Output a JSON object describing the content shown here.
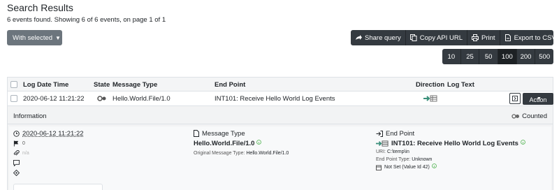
{
  "header": {
    "title": "Search Results",
    "summary": "6 events found. Showing 6 of 6 events, on page 1 of 1"
  },
  "bulk": {
    "with_selected_label": "With selected"
  },
  "toolbar": {
    "share_query": "Share query",
    "copy_api_url": "Copy API URL",
    "print": "Print",
    "export_csv": "Export to CSV"
  },
  "pager": {
    "sizes": [
      "10",
      "25",
      "50",
      "100",
      "200",
      "500"
    ],
    "active": "100"
  },
  "table": {
    "columns": {
      "log_date_time": "Log Date Time",
      "state": "State",
      "message_type": "Message Type",
      "end_point": "End Point",
      "direction": "Direction",
      "log_text": "Log Text"
    },
    "rows": [
      {
        "log_date_time": "2020-06-12 11:21:22",
        "message_type": "Hello.World.File/1.0",
        "end_point": "INT101: Receive Hello World Log Events",
        "action_label": "Action"
      }
    ]
  },
  "detail": {
    "information_label": "Information",
    "counted_label": "Counted",
    "left": {
      "date_time": "2020-06-12 11:21:22",
      "flag_value": "0",
      "attachment_value": "n/a"
    },
    "message": {
      "header": "Message Type",
      "name": "Hello.World.File/1.0",
      "original_label": "Original Message Type:",
      "original_value": "Hello.World.File/1.0"
    },
    "endpoint": {
      "header": "End Point",
      "name": "INT101: Receive Hello World Log Events",
      "uri_label": "URI:",
      "uri_value": "C:\\temp\\in",
      "type_label": "End Point Type:",
      "type_value": "Unknown",
      "status_value": "Not Set (Value Id 42)"
    }
  },
  "colors": {
    "dark": "#343a40",
    "secondary": "#6c757d",
    "direction_green": "#3a8f7a",
    "info_green": "#5cb85c"
  }
}
